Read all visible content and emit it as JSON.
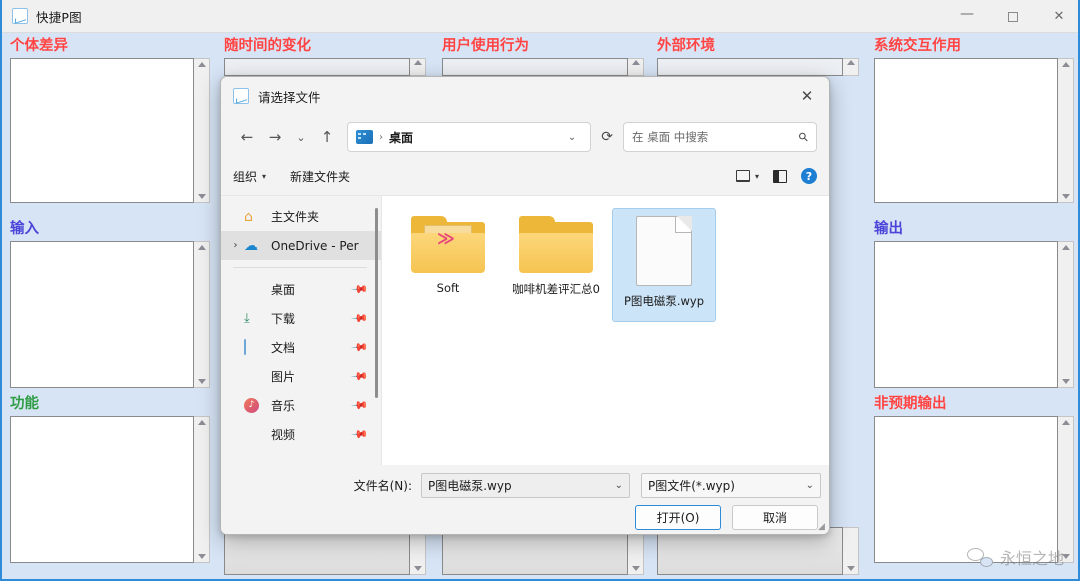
{
  "app": {
    "title": "快捷P图",
    "title_icon": "chart-icon",
    "window_controls": {
      "minimize": "—",
      "maximize": "□",
      "close": "✕"
    }
  },
  "panels": [
    {
      "label": "个体差异",
      "color": "#ff4444"
    },
    {
      "label": "随时间的变化",
      "color": "#ff4444"
    },
    {
      "label": "用户使用行为",
      "color": "#ff4444"
    },
    {
      "label": "外部环境",
      "color": "#ff4444"
    },
    {
      "label": "系统交互作用",
      "color": "#ff4444"
    },
    {
      "label": "输入",
      "color": "#4a45d8"
    },
    {
      "label": "输出",
      "color": "#4a45d8"
    },
    {
      "label": "功能",
      "color": "#2e9b45"
    },
    {
      "label": "非预期输出",
      "color": "#ff4444"
    }
  ],
  "dialog": {
    "title": "请选择文件",
    "close_label": "✕",
    "nav": {
      "back": "←",
      "forward": "→",
      "recent": "⌄",
      "up": "↑",
      "address_crumb": "桌面",
      "address_separator": "›",
      "address_caret": "⌄",
      "refresh": "⟳",
      "search_placeholder": "在 桌面 中搜索",
      "search_icon": "search-icon"
    },
    "commandbar": {
      "organize": "组织",
      "organize_caret": "▾",
      "new_folder": "新建文件夹",
      "view_caret": "▾",
      "view_icon": "view-layout-icon",
      "preview_icon": "preview-pane-icon",
      "help_icon": "?"
    },
    "sidebar": [
      {
        "name": "主文件夹",
        "icon": "home-icon",
        "expander": "",
        "pin": false,
        "selected": false
      },
      {
        "name": "OneDrive - Per",
        "icon": "cloud-icon",
        "expander": "›",
        "pin": false,
        "selected": true
      },
      {
        "name": "桌面",
        "icon": "desktop-icon",
        "expander": "",
        "pin": true,
        "selected": false
      },
      {
        "name": "下载",
        "icon": "download-icon",
        "expander": "",
        "pin": true,
        "selected": false
      },
      {
        "name": "文档",
        "icon": "document-icon",
        "expander": "",
        "pin": true,
        "selected": false
      },
      {
        "name": "图片",
        "icon": "pictures-icon",
        "expander": "",
        "pin": true,
        "selected": false
      },
      {
        "name": "音乐",
        "icon": "music-icon",
        "expander": "",
        "pin": true,
        "selected": false
      },
      {
        "name": "视频",
        "icon": "video-icon",
        "expander": "",
        "pin": true,
        "selected": false
      }
    ],
    "files": [
      {
        "name": "Soft",
        "type": "folder-special",
        "selected": false
      },
      {
        "name": "咖啡机差评汇总0",
        "type": "folder",
        "selected": false
      },
      {
        "name": "P图电磁泵.wyp",
        "type": "file",
        "selected": true
      }
    ],
    "footer": {
      "filename_label": "文件名(N):",
      "filename_value": "P图电磁泵.wyp",
      "filename_caret": "⌄",
      "filter_value": "P图文件(*.wyp)",
      "filter_caret": "⌄",
      "open_button": "打开(O)",
      "cancel_button": "取消"
    }
  },
  "watermark": {
    "text": "永恒之地",
    "icon": "wechat-icon"
  }
}
